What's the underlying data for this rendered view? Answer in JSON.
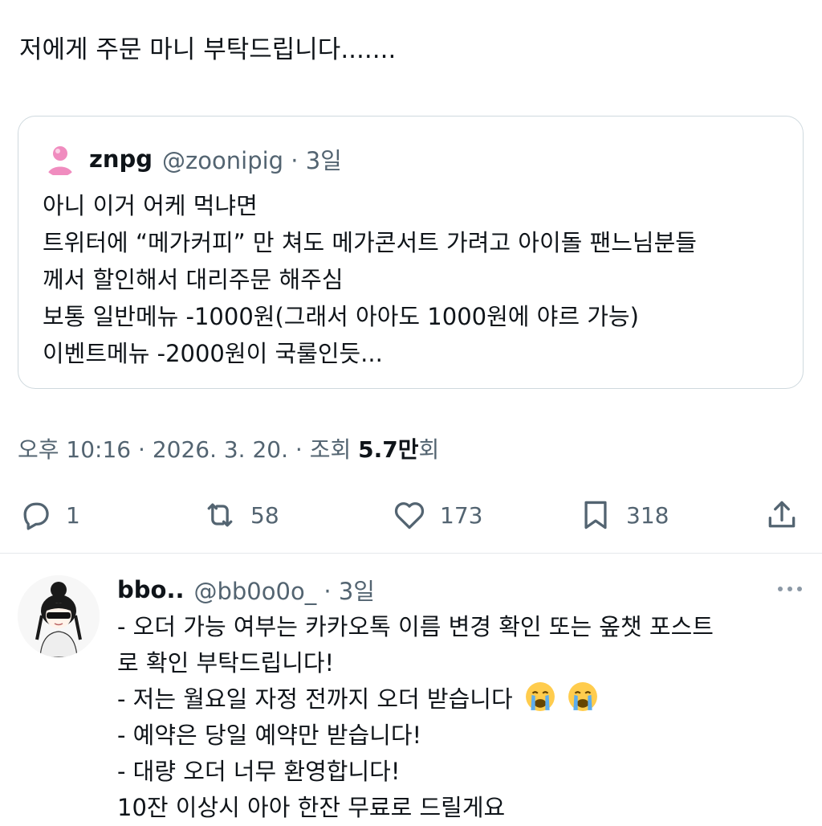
{
  "post": {
    "text": "저에게 주문 마니 부탁드립니다.......",
    "quote": {
      "name": "znpg",
      "handle_time": "@zoonipig · 3일",
      "lines": [
        "아니 이거 어케 먹냐면",
        "트위터에 “메가커피” 만 쳐도 메가콘서트 가려고 아이돌 팬느님분들",
        "께서 할인해서 대리주문 해주심",
        "보통 일반메뉴 -1000원(그래서 아아도 1000원에 야르 가능)",
        "이벤트메뉴 -2000원이 국룰인듯..."
      ]
    },
    "meta": {
      "time_date": "오후 10:16 · 2026. 3. 20. · 조회 ",
      "views": "5.7만",
      "views_suffix": "회"
    },
    "actions": {
      "replies": "1",
      "reposts": "58",
      "likes": "173",
      "bookmarks": "318"
    }
  },
  "reply": {
    "name": "bbo..",
    "handle_time": "@bb0o0o_ · 3일",
    "lines": [
      "- 오더 가능 여부는 카카오톡 이름 변경 확인 또는 옾챗 포스트",
      "로 확인 부탁드립니다!",
      "- 저는 월요일 자정 전까지 오더 받습니다",
      "- 예약은 당일 예약만 받습니다!",
      "- 대량 오더 너무 환영합니다!",
      "10잔 이상시 아아 한잔 무료로 드릴게요"
    ],
    "emoji": [
      "crying-face-emoji",
      "crying-face-emoji"
    ]
  },
  "colors": {
    "text": "#0f1419",
    "secondary": "#536471",
    "border": "#cfd9de",
    "avatar_pink": "#f08cbf"
  }
}
